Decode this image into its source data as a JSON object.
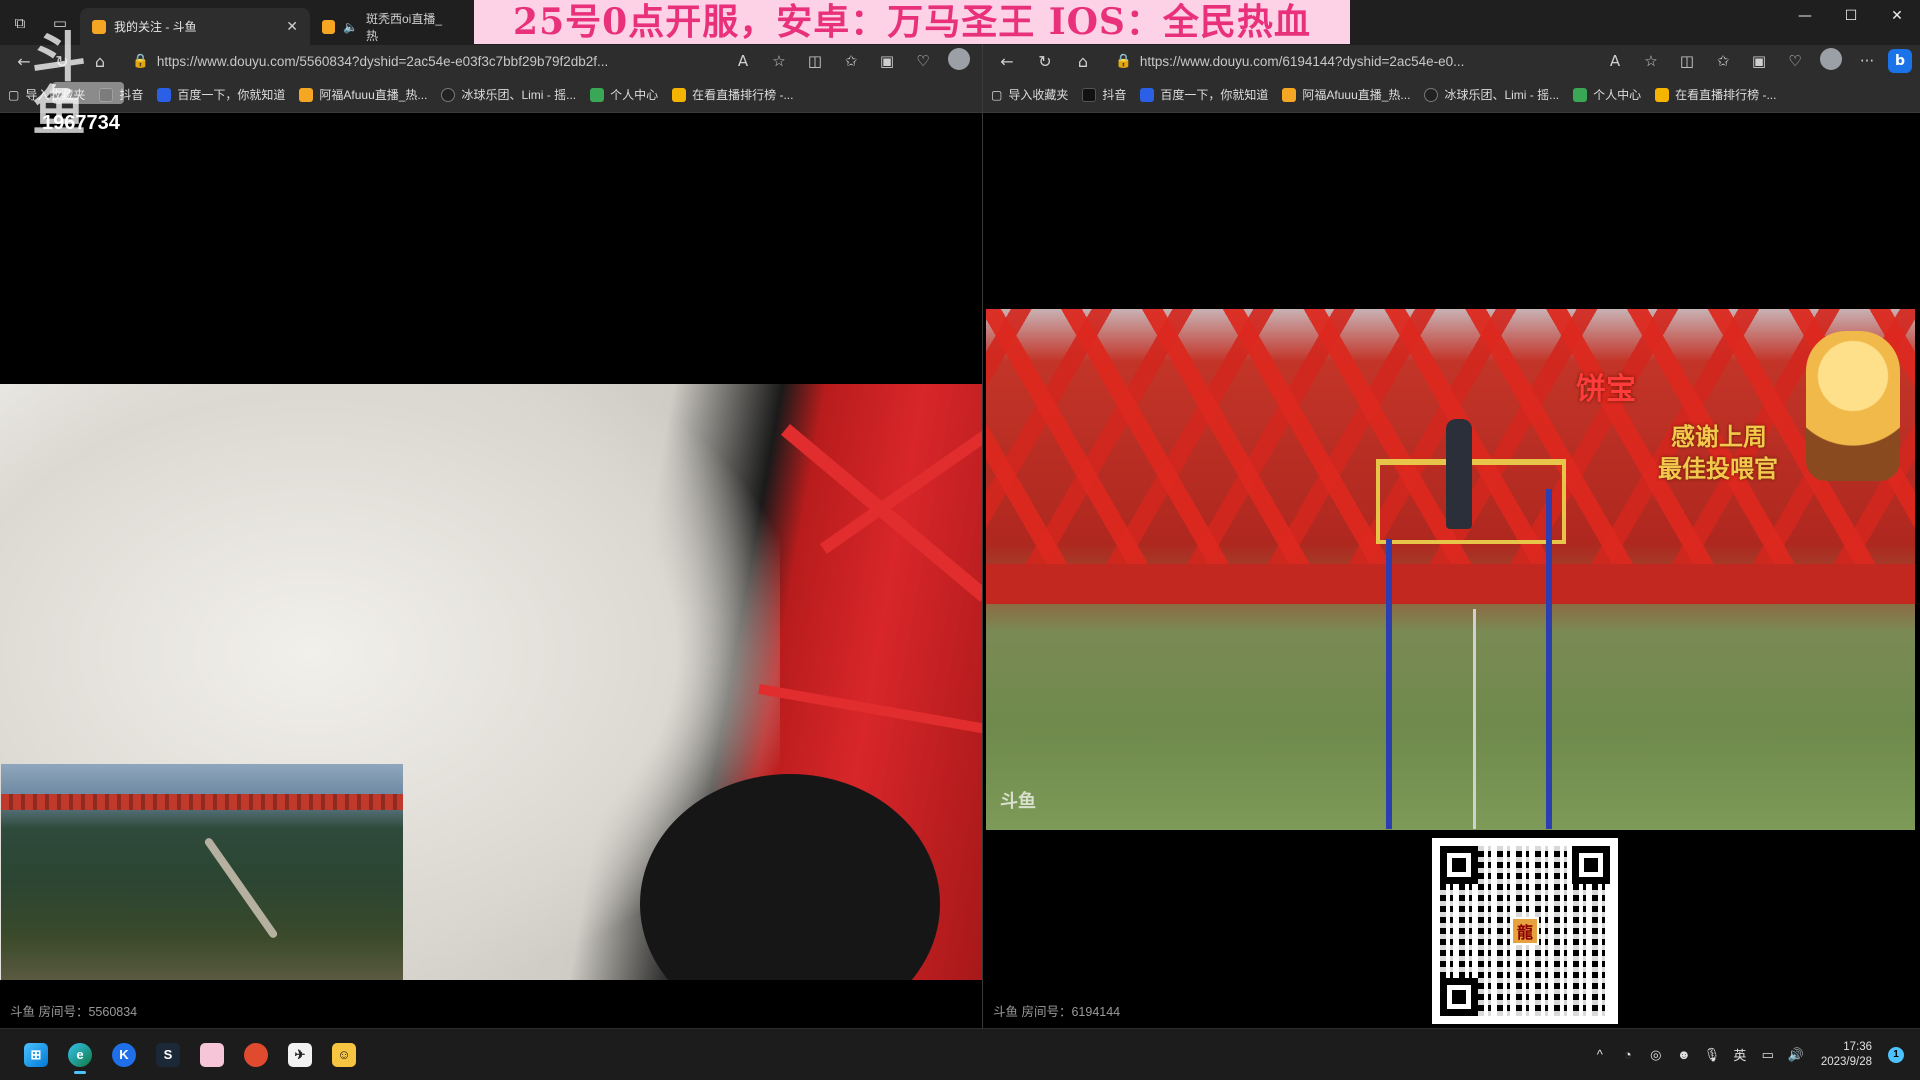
{
  "left_browser": {
    "tabs": [
      {
        "title": "我的关注 - 斗鱼",
        "active": true
      },
      {
        "title": "斑秃西oi直播_热",
        "active": false
      }
    ],
    "url": "https://www.douyu.com/5560834?dyshid=2ac54e-e03f3c7bbf29b79f2db2f...",
    "bookmarks": [
      "导入收藏夹",
      "抖音",
      "百度一下，你就知道",
      "阿福Afuuu直播_热...",
      "冰球乐团、Limi - 摇...",
      "个人中心",
      "在看直播排行榜 -..."
    ],
    "viewer_count": "1967734",
    "room_number": "斗鱼 房间号：5560834"
  },
  "promo_banner": "25号0点开服，安卓：万马圣王 IOS：全民热血",
  "right_browser": {
    "url": "https://www.douyu.com/6194144?dyshid=2ac54e-e0...",
    "bookmarks": [
      "导入收藏夹",
      "抖音",
      "百度一下，你就知道",
      "阿福Afuuu直播_热...",
      "冰球乐团、Limi - 摇...",
      "个人中心",
      "在看直播排行榜 -..."
    ],
    "overlay_name": "饼宝",
    "overlay_thanks": "感谢上周",
    "overlay_title": "最佳投喂官",
    "video_watermark": "斗鱼",
    "qr_center": "龍",
    "room_number": "斗鱼 房间号：6194144"
  },
  "window_controls": {
    "minimize": "—",
    "maximize": "☐",
    "close": "✕"
  },
  "taskbar": {
    "apps": [
      "start",
      "edge",
      "kugou",
      "steam",
      "app-pink",
      "app-red",
      "app-plane",
      "app-face"
    ],
    "tray_lang": "英",
    "time": "17:36",
    "date": "2023/9/28",
    "notification_count": "1"
  },
  "colors": {
    "banner_bg": "#fdd1e6",
    "banner_text": "#e8317a",
    "taskbar_accent": "#4cc2ff"
  }
}
